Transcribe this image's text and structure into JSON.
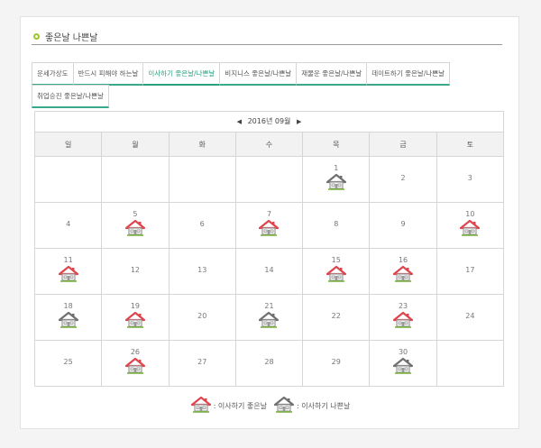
{
  "header": {
    "title": "좋은날 나쁜날"
  },
  "tabs": [
    {
      "label": "운세가상도",
      "active": false,
      "row": 0
    },
    {
      "label": "반드시 피해야 하는날",
      "active": false,
      "row": 0
    },
    {
      "label": "이사하기 좋은날/나쁜날",
      "active": true,
      "row": 0
    },
    {
      "label": "비지니스 좋은날/나쁜날",
      "active": false,
      "row": 0
    },
    {
      "label": "재물운 좋은날/나쁜날",
      "active": false,
      "row": 0
    },
    {
      "label": "데이트하기 좋은날/나쁜날",
      "active": false,
      "row": 0
    },
    {
      "label": "취업승진 좋은날/나쁜날",
      "active": false,
      "row": 1
    }
  ],
  "calendar": {
    "month_label": "2016년 09월",
    "prev": "◀",
    "next": "▶",
    "weekdays": [
      "일",
      "월",
      "화",
      "수",
      "목",
      "금",
      "토"
    ],
    "weeks": [
      [
        null,
        null,
        null,
        null,
        {
          "day": "1",
          "mark": "bad"
        },
        {
          "day": "2",
          "mark": ""
        },
        {
          "day": "3",
          "mark": ""
        }
      ],
      [
        {
          "day": "4",
          "mark": ""
        },
        {
          "day": "5",
          "mark": "good"
        },
        {
          "day": "6",
          "mark": ""
        },
        {
          "day": "7",
          "mark": "good"
        },
        {
          "day": "8",
          "mark": ""
        },
        {
          "day": "9",
          "mark": ""
        },
        {
          "day": "10",
          "mark": "good"
        }
      ],
      [
        {
          "day": "11",
          "mark": "good"
        },
        {
          "day": "12",
          "mark": ""
        },
        {
          "day": "13",
          "mark": ""
        },
        {
          "day": "14",
          "mark": ""
        },
        {
          "day": "15",
          "mark": "good"
        },
        {
          "day": "16",
          "mark": "good"
        },
        {
          "day": "17",
          "mark": ""
        }
      ],
      [
        {
          "day": "18",
          "mark": "bad"
        },
        {
          "day": "19",
          "mark": "good"
        },
        {
          "day": "20",
          "mark": ""
        },
        {
          "day": "21",
          "mark": "bad"
        },
        {
          "day": "22",
          "mark": ""
        },
        {
          "day": "23",
          "mark": "good"
        },
        {
          "day": "24",
          "mark": ""
        }
      ],
      [
        {
          "day": "25",
          "mark": ""
        },
        {
          "day": "26",
          "mark": "good"
        },
        {
          "day": "27",
          "mark": ""
        },
        {
          "day": "28",
          "mark": ""
        },
        {
          "day": "29",
          "mark": ""
        },
        {
          "day": "30",
          "mark": "bad"
        },
        null
      ]
    ]
  },
  "legend": {
    "good_label": ": 이사하기 좋은날",
    "bad_label": ": 이사하기 나쁜날"
  },
  "colors": {
    "accent": "#2aa07f",
    "good_roof": "#e0454e",
    "bad_roof": "#707070",
    "house_body": "#9a9a9a",
    "ground": "#7cb342"
  },
  "icons": {
    "good": "house-good-icon",
    "bad": "house-bad-icon"
  }
}
